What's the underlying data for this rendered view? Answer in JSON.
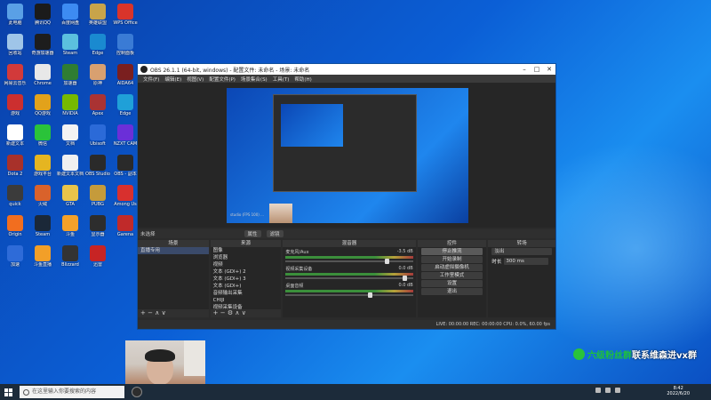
{
  "desktop": {
    "icons": [
      {
        "label": "此电脑",
        "color": "#5aa0e6"
      },
      {
        "label": "腾讯QQ",
        "color": "#1b1b1b"
      },
      {
        "label": "百度网盘",
        "color": "#3d8bf2"
      },
      {
        "label": "英雄联盟",
        "color": "#c8a44a"
      },
      {
        "label": "WPS Office",
        "color": "#d9342b"
      },
      {
        "label": "回收站",
        "color": "#9fc5e8"
      },
      {
        "label": "奇游加速器",
        "color": "#1d1d1d"
      },
      {
        "label": "Steam",
        "color": "#5bc0de"
      },
      {
        "label": "Edge",
        "color": "#1a8ad0"
      },
      {
        "label": "控制面板",
        "color": "#3a7bd5"
      },
      {
        "label": "网易云音乐",
        "color": "#d23a3a"
      },
      {
        "label": "Chrome",
        "color": "#e8e8e8"
      },
      {
        "label": "加速器",
        "color": "#2f7d32"
      },
      {
        "label": "原神",
        "color": "#d8a070"
      },
      {
        "label": "AIDA64",
        "color": "#7a1f1f"
      },
      {
        "label": "游戏",
        "color": "#cc2f2f"
      },
      {
        "label": "QQ游戏",
        "color": "#e2a21b"
      },
      {
        "label": "NVIDIA",
        "color": "#76b900"
      },
      {
        "label": "Apex",
        "color": "#a33"
      },
      {
        "label": "Edge",
        "color": "#1fa0d8"
      },
      {
        "label": "新建文本",
        "color": "#ffffff"
      },
      {
        "label": "微信",
        "color": "#2ac33a"
      },
      {
        "label": "文档",
        "color": "#f3f3f3"
      },
      {
        "label": "Ubisoft",
        "color": "#2b6ad8"
      },
      {
        "label": "NZXT CAM",
        "color": "#6b2fd8"
      },
      {
        "label": "Dota 2",
        "color": "#a8312a"
      },
      {
        "label": "游戏平台",
        "color": "#e5b521"
      },
      {
        "label": "新建文本文档",
        "color": "#f0f0f0"
      },
      {
        "label": "OBS Studio",
        "color": "#2a2a2a"
      },
      {
        "label": "OBS - 副本",
        "color": "#2a2a2a"
      },
      {
        "label": "quick",
        "color": "#3b3b3b"
      },
      {
        "label": "火绒",
        "color": "#d9622b"
      },
      {
        "label": "GTA",
        "color": "#e8c44a"
      },
      {
        "label": "PUBG",
        "color": "#c59b3b"
      },
      {
        "label": "Among Us",
        "color": "#d8302e"
      },
      {
        "label": "Origin",
        "color": "#f26e1f"
      },
      {
        "label": "Steam",
        "color": "#1b2838"
      },
      {
        "label": "斗鱼",
        "color": "#f4a12a"
      },
      {
        "label": "显示器",
        "color": "#2d2d2d"
      },
      {
        "label": "Garena",
        "color": "#c02a2a"
      },
      {
        "label": "加速",
        "color": "#2e6bd8"
      },
      {
        "label": "斗鱼直播",
        "color": "#f29f28"
      },
      {
        "label": "Blizzard",
        "color": "#333"
      },
      {
        "label": "迅雷",
        "color": "#c72424"
      }
    ]
  },
  "obs": {
    "title": "OBS 26.1.1 (64-bit, windows) - 配置文件: 未命名 - 场景: 未命名",
    "menu": [
      "文件(F)",
      "编辑(E)",
      "视图(V)",
      "配置文件(P)",
      "场景集合(S)",
      "工具(T)",
      "帮助(H)"
    ],
    "scene_bar": {
      "label": "未选择",
      "props": "属性",
      "filters": "滤镜"
    },
    "docks": {
      "scenes": {
        "title": "场景",
        "items": [
          "直播专用"
        ]
      },
      "sources": {
        "title": "来源",
        "items": [
          "图像",
          "浏览器",
          "视频",
          "文本 (GDI+) 2",
          "文本 (GDI+) 3",
          "文本 (GDI+)",
          "音频输出采集",
          "CHIJI",
          "视频采集设备"
        ]
      },
      "mixer": {
        "title": "混音器",
        "channels": [
          {
            "name": "麦克风/Aux",
            "db": "-3.5 dB",
            "level": 0.85
          },
          {
            "name": "视频采集设备",
            "db": "0.0 dB",
            "level": 1.0
          },
          {
            "name": "桌面音频",
            "db": "0.0 dB",
            "level": 0.7
          }
        ]
      },
      "transitions": {
        "title": "转场",
        "type": "淡出",
        "duration_label": "时长",
        "duration": "300 ms"
      },
      "controls": {
        "title": "控件",
        "buttons": [
          "停止推流",
          "开始录制",
          "启动虚拟摄像机",
          "工作室模式",
          "设置",
          "退出"
        ]
      }
    },
    "status": "LIVE: 00:00:00   REC: 00:00:00   CPU: 0.0%, 60.00 fps",
    "preview_caption": "studio (FPS 100) ..."
  },
  "ad": {
    "prefix": "六级粉丝群",
    "suffix": "联系维森进vx群"
  },
  "taskbar": {
    "search_placeholder": "在这里输入你要搜索的内容",
    "time": "8:42",
    "date": "2022/6/20"
  }
}
